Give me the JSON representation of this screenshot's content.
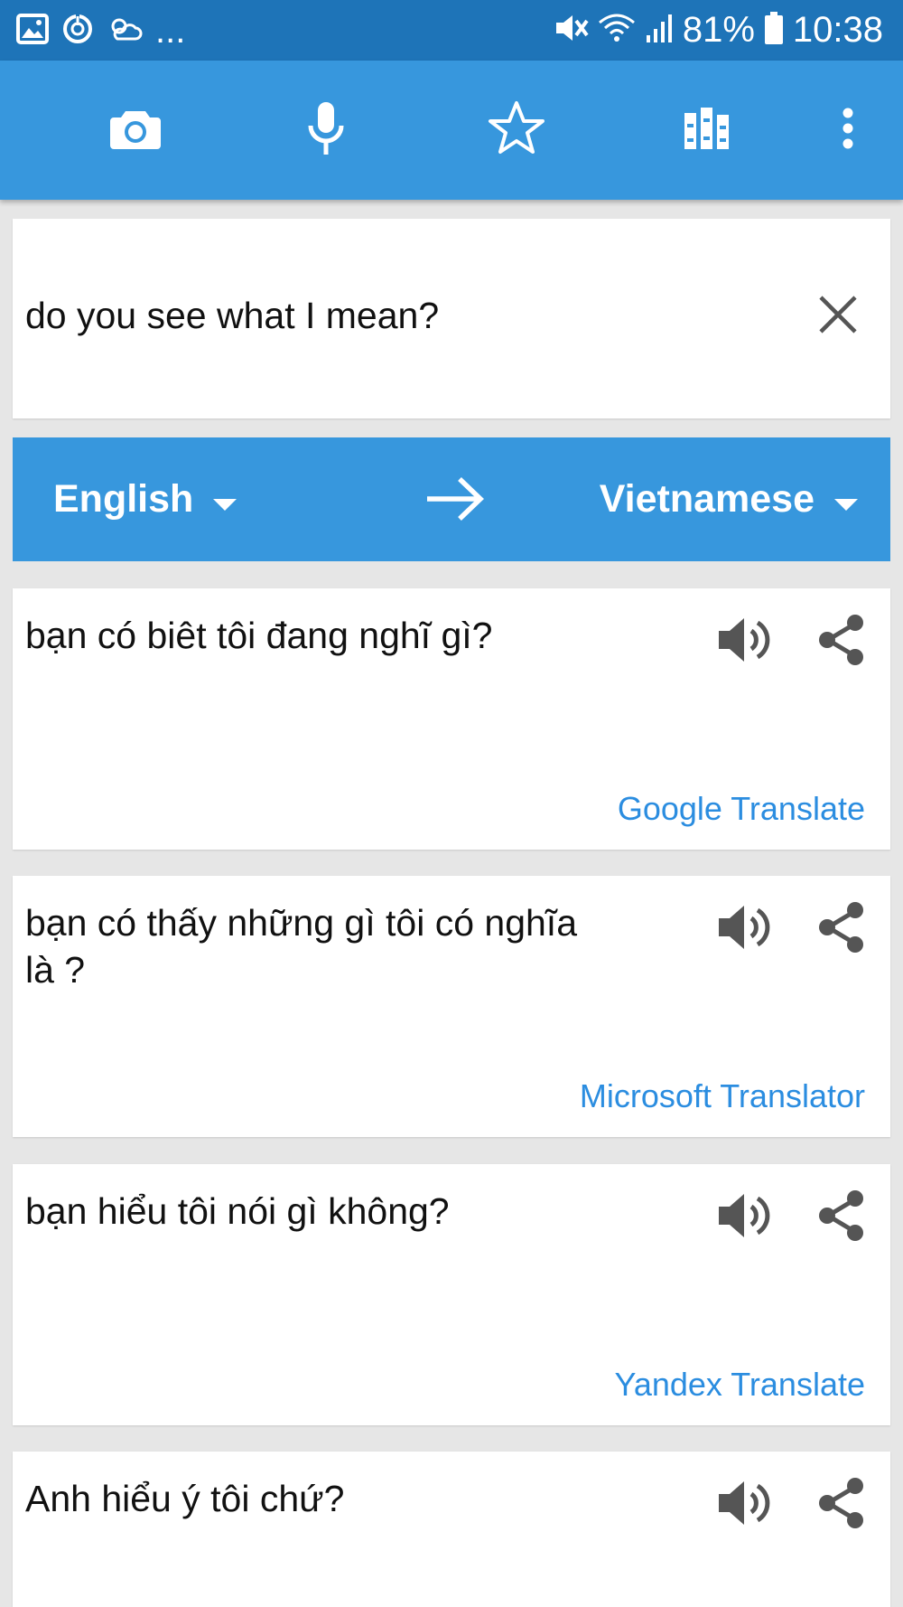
{
  "status_bar": {
    "battery": "81%",
    "time": "10:38",
    "more_notifications": "...",
    "icons": [
      "image-icon",
      "sync-icon",
      "weather-icon",
      "mute-icon",
      "wifi-icon",
      "signal-icon",
      "battery-icon"
    ]
  },
  "toolbar": {
    "icons": [
      "camera-icon",
      "microphone-icon",
      "star-icon",
      "library-icon",
      "more-vert-icon"
    ]
  },
  "input": {
    "text": "do you see what I mean?"
  },
  "languages": {
    "source": "English",
    "target": "Vietnamese"
  },
  "results": [
    {
      "text": "bạn có biêt tôi đang nghĩ gì?",
      "provider": "Google Translate"
    },
    {
      "text": "bạn có thấy những gì tôi có nghĩa là ?",
      "provider": "Microsoft Translator"
    },
    {
      "text": "bạn hiểu tôi nói gì không?",
      "provider": "Yandex Translate"
    },
    {
      "text": "Anh hiểu ý tôi chứ?",
      "provider": ""
    }
  ],
  "colors": {
    "status_bar": "#1e74b8",
    "primary": "#3797dd",
    "link": "#2b8de0",
    "background": "#e6e6e6"
  }
}
